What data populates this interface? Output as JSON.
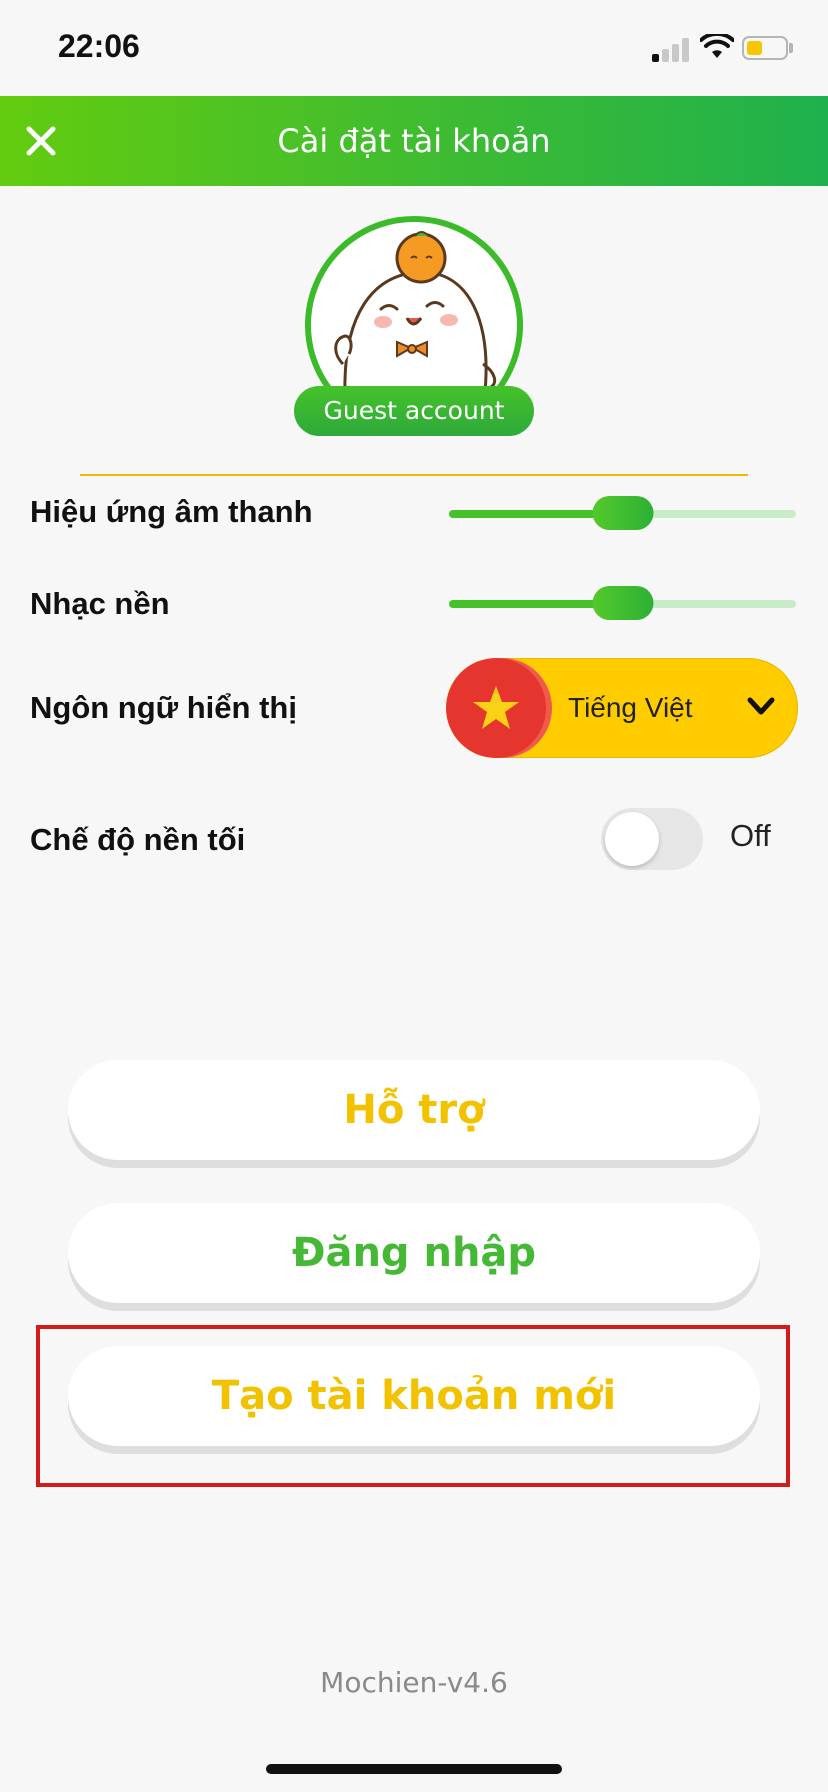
{
  "status_bar": {
    "time": "22:06",
    "icons": [
      "cellular-signal-icon",
      "wifi-icon",
      "battery-icon"
    ],
    "battery_color": "#f6c700"
  },
  "header": {
    "title": "Cài đặt tài khoản",
    "close_icon": "close-icon",
    "gradient": [
      "#63cc0f",
      "#1fb14d"
    ]
  },
  "profile": {
    "badge": "Guest account",
    "avatar_icon": "mascot-avatar-icon"
  },
  "settings": {
    "sound_effects": {
      "label": "Hiệu ứng âm thanh",
      "level": 0.5
    },
    "background_music": {
      "label": "Nhạc nền",
      "level": 0.5
    },
    "display_language": {
      "label": "Ngôn ngữ hiển thị",
      "value": "Tiếng Việt",
      "flag_icon": "vietnam-flag-icon"
    },
    "dark_mode": {
      "label": "Chế độ nền tối",
      "state": "Off"
    }
  },
  "buttons": {
    "help": "Hỗ trợ",
    "login": "Đăng nhập",
    "create_account": "Tạo tài khoản mới"
  },
  "colors": {
    "accent_green": "#45b936",
    "accent_yellow": "#f2c200",
    "highlight_red": "#d21c1c"
  },
  "version": "Mochien-v4.6"
}
